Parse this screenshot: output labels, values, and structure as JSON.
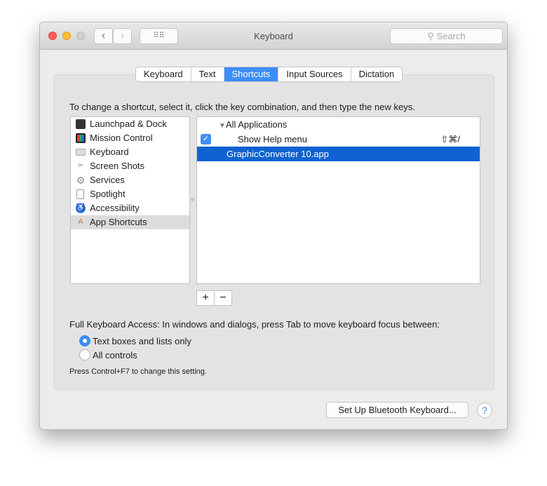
{
  "window": {
    "title": "Keyboard",
    "search_placeholder": "Search"
  },
  "tabs": [
    {
      "label": "Keyboard"
    },
    {
      "label": "Text"
    },
    {
      "label": "Shortcuts",
      "selected": true
    },
    {
      "label": "Input Sources"
    },
    {
      "label": "Dictation"
    }
  ],
  "instructions": "To change a shortcut, select it, click the key combination, and then type the new keys.",
  "categories": [
    {
      "label": "Launchpad & Dock",
      "icon": "launchpad-icon"
    },
    {
      "label": "Mission Control",
      "icon": "mission-control-icon"
    },
    {
      "label": "Keyboard",
      "icon": "keyboard-icon"
    },
    {
      "label": "Screen Shots",
      "icon": "screenshot-icon"
    },
    {
      "label": "Services",
      "icon": "gear-icon"
    },
    {
      "label": "Spotlight",
      "icon": "spotlight-icon"
    },
    {
      "label": "Accessibility",
      "icon": "accessibility-icon"
    },
    {
      "label": "App Shortcuts",
      "icon": "app-shortcuts-icon",
      "selected": true
    }
  ],
  "shortcuts": {
    "group": "All Applications",
    "item": "Show Help menu",
    "item_checked": true,
    "item_keys": "⇧⌘/",
    "app": "GraphicConverter 10.app"
  },
  "buttons": {
    "add": "+",
    "remove": "−",
    "bluetooth": "Set Up Bluetooth Keyboard...",
    "help": "?"
  },
  "full_access": {
    "label": "Full Keyboard Access: In windows and dialogs, press Tab to move keyboard focus between:",
    "options": [
      {
        "label": "Text boxes and lists only",
        "selected": true
      },
      {
        "label": "All controls",
        "selected": false
      }
    ],
    "note": "Press Control+F7 to change this setting."
  },
  "colors": {
    "accent": "#3d8ef5",
    "selection": "#0f62d0"
  }
}
